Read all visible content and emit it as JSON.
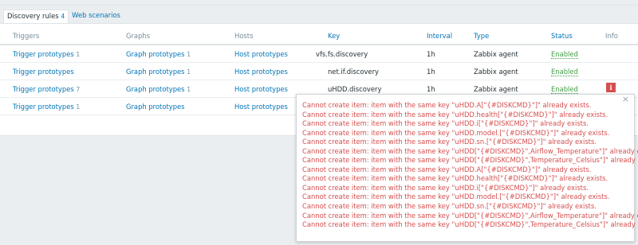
{
  "tabs": [
    {
      "label": "Discovery rules",
      "count": "4"
    },
    {
      "label": "Web scenarios"
    }
  ],
  "columns": {
    "triggers": "Triggers",
    "graphs": "Graphs",
    "hosts": "Hosts",
    "key": "Key",
    "interval": "Interval",
    "type": "Type",
    "status": "Status",
    "info": "Info"
  },
  "rows": [
    {
      "triggers": "Trigger prototypes",
      "triggers_count": "1",
      "graphs": "Graph prototypes",
      "graphs_count": "1",
      "hosts": "Host prototypes",
      "key": "vfs.fs.discovery",
      "interval": "1h",
      "type": "Zabbix agent",
      "status": "Enabled"
    },
    {
      "triggers": "Trigger prototypes",
      "triggers_count": "",
      "graphs": "Graph prototypes",
      "graphs_count": "1",
      "hosts": "Host prototypes",
      "key": "net.if.discovery",
      "interval": "1h",
      "type": "Zabbix agent",
      "status": "Enabled"
    },
    {
      "triggers": "Trigger prototypes",
      "triggers_count": "7",
      "graphs": "Graph prototypes",
      "graphs_count": "1",
      "hosts": "Host prototypes",
      "key": "uHDD.discovery",
      "interval": "1h",
      "type": "Zabbix agent",
      "status": "Enabled",
      "info_icon": "error-info-icon"
    },
    {
      "triggers": "Trigger prototypes",
      "triggers_count": "1",
      "graphs": "Graph prototypes",
      "graphs_count": "",
      "hosts": "Host prototypes",
      "key": "",
      "interval": "",
      "type": "",
      "status": ""
    }
  ],
  "popup": {
    "close": "×",
    "errors": [
      "Cannot create item: item with the same key \"uHDD.A[\"{#DISKCMD}\"]\" already exists.",
      "Cannot create item: item with the same key \"uHDD.health[\"{#DISKCMD}\"]\" already exists.",
      "Cannot create item: item with the same key \"uHDD.i[\"{#DISKCMD}\"]\" already exists.",
      "Cannot create item: item with the same key \"uHDD.model.[\"{#DISKCMD}\"]\" already exists.",
      "Cannot create item: item with the same key \"uHDD.sn.[\"{#DISKCMD}\"]\" already exists.",
      "Cannot create item: item with the same key \"uHDD[\"{#DISKCMD}\",Airflow_Temperature\"]\" already exists.",
      "Cannot create item: item with the same key \"uHDD[\"{#DISKCMD}\",Temperature_Celsius\"]\" already exists.",
      "Cannot create item: item with the same key \"uHDD.A[\"{#DISKCMD}\"]\" already exists.",
      "Cannot create item: item with the same key \"uHDD.health[\"{#DISKCMD}\"]\" already exists.",
      "Cannot create item: item with the same key \"uHDD.i[\"{#DISKCMD}\"]\" already exists.",
      "Cannot create item: item with the same key \"uHDD.model.[\"{#DISKCMD}\"]\" already exists.",
      "Cannot create item: item with the same key \"uHDD.sn.[\"{#DISKCMD}\"]\" already exists.",
      "Cannot create item: item with the same key \"uHDD[\"{#DISKCMD}\",Airflow_Temperature\"]\" already exists.",
      "Cannot create item: item with the same key \"uHDD[\"{#DISKCMD}\",Temperature_Celsius\"]\" already exists."
    ]
  },
  "colors": {
    "link": "#0275b8",
    "enabled": "#429e47",
    "error": "#d64e4e",
    "header_text": "#768d99"
  }
}
